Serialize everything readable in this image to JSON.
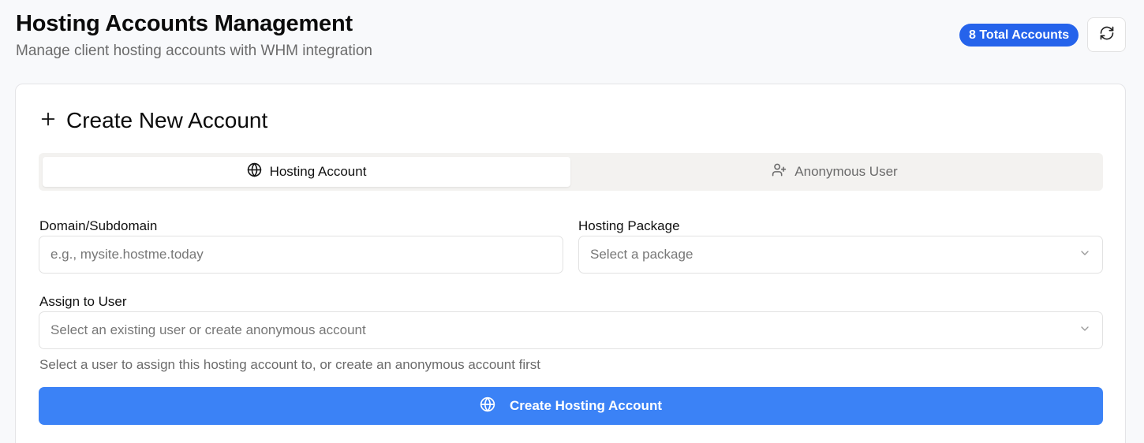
{
  "header": {
    "title": "Hosting Accounts Management",
    "subtitle": "Manage client hosting accounts with WHM integration",
    "total_badge": "8 Total Accounts",
    "refresh_icon": "refresh-icon"
  },
  "create_card": {
    "title": "Create New Account",
    "title_icon": "plus-icon",
    "tabs": [
      {
        "label": "Hosting Account",
        "icon": "globe-icon",
        "active": true
      },
      {
        "label": "Anonymous User",
        "icon": "user-plus-icon",
        "active": false
      }
    ],
    "domain": {
      "label": "Domain/Subdomain",
      "placeholder": "e.g., mysite.hostme.today",
      "value": ""
    },
    "package": {
      "label": "Hosting Package",
      "selected": "Select a package"
    },
    "user": {
      "label": "Assign to User",
      "selected": "Select an existing user or create anonymous account",
      "helper": "Select a user to assign this hosting account to, or create an anonymous account first"
    },
    "submit_label": "Create Hosting Account"
  },
  "colors": {
    "primary": "#3b82f6",
    "badge": "#2563eb",
    "background": "#f8f9fb"
  }
}
